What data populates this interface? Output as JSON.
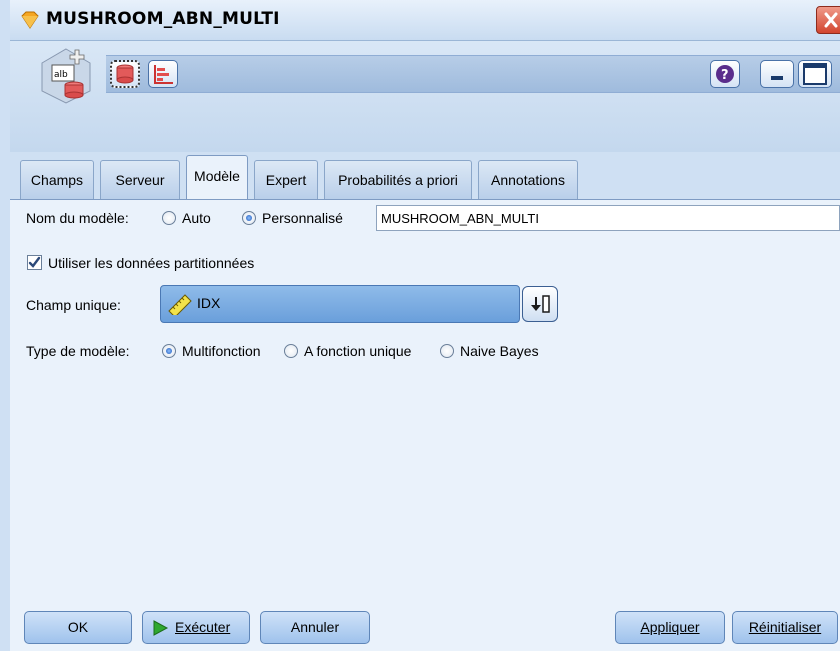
{
  "window": {
    "title": "MUSHROOM_ABN_MULTI"
  },
  "tabs": [
    {
      "label": "Champs"
    },
    {
      "label": "Serveur"
    },
    {
      "label": "Modèle"
    },
    {
      "label": "Expert"
    },
    {
      "label": "Probabilités a priori"
    },
    {
      "label": "Annotations"
    }
  ],
  "model": {
    "name_label": "Nom du modèle:",
    "name_options": [
      "Auto",
      "Personnalisé"
    ],
    "name_selected": "Personnalisé",
    "name_value": "MUSHROOM_ABN_MULTI",
    "partition_label": "Utiliser les données partitionnées",
    "partition_checked": true,
    "unique_field_label": "Champ unique:",
    "unique_field_value": "IDX",
    "type_label": "Type de modèle:",
    "type_options": [
      "Multifonction",
      "A fonction unique",
      "Naive Bayes"
    ],
    "type_selected": "Multifonction"
  },
  "buttons": {
    "ok": "OK",
    "run": "Exécuter",
    "cancel": "Annuler",
    "apply": "Appliquer",
    "reset": "Réinitialiser"
  },
  "icons": {
    "title": "diamond-node-icon",
    "node": "model-node-icon",
    "toolbar": [
      "database-icon",
      "chart-icon"
    ],
    "help": "help-icon",
    "minimize": "minimize-icon",
    "maximize": "maximize-icon",
    "close": "close-icon",
    "field": "ruler-icon",
    "picker": "field-picker-icon",
    "run": "play-icon"
  },
  "colors": {
    "accent": "#2d5ea8",
    "title_icon": "#f5a623",
    "run_icon": "#2fa82f"
  }
}
